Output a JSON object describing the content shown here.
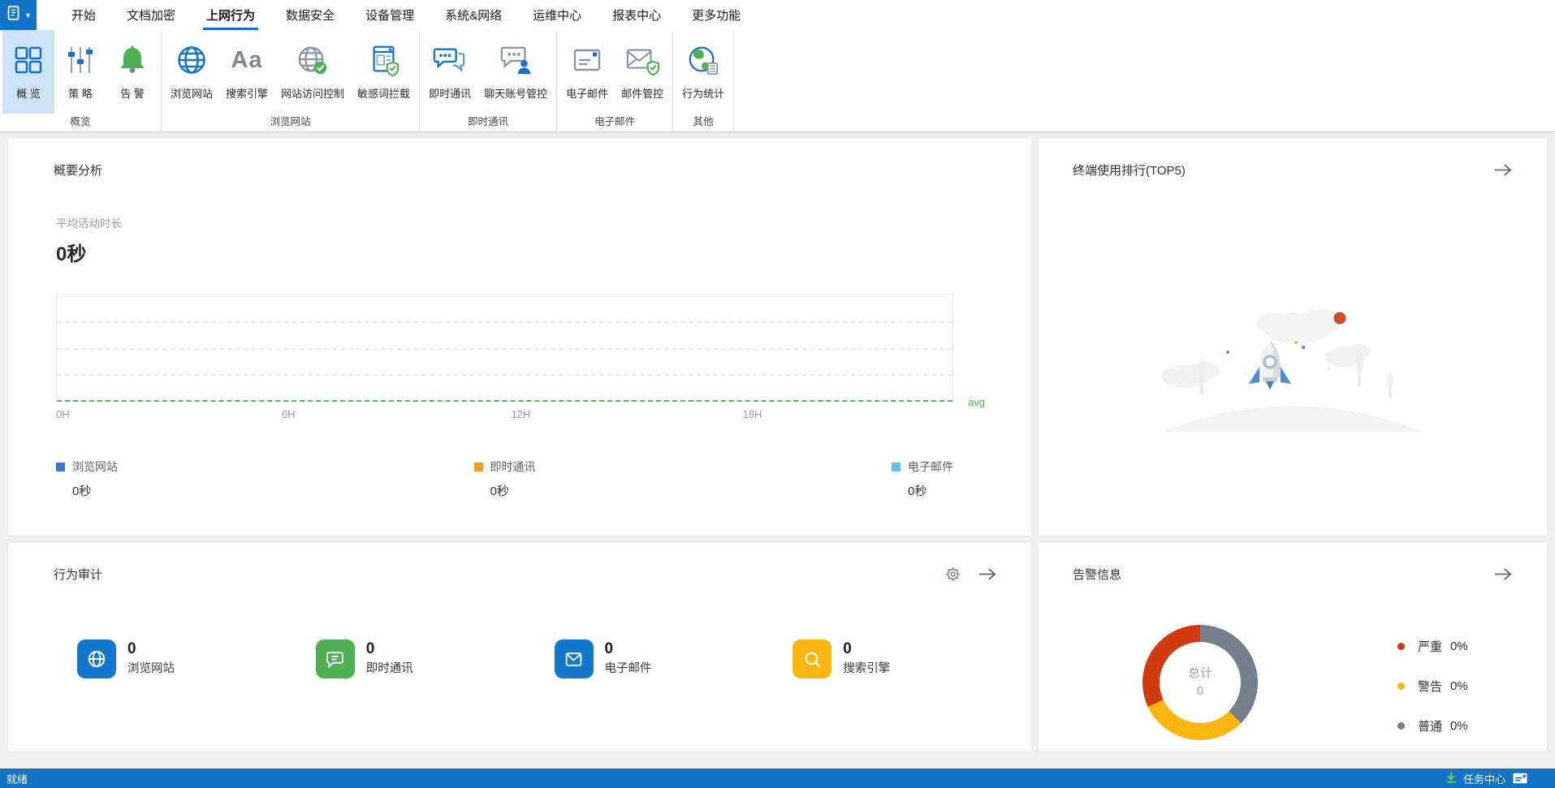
{
  "menubar": {
    "tabs": [
      "开始",
      "文档加密",
      "上网行为",
      "数据安全",
      "设备管理",
      "系统&网络",
      "运维中心",
      "报表中心",
      "更多功能"
    ],
    "active_tab": "上网行为"
  },
  "ribbon": {
    "groups": [
      {
        "label": "概览",
        "buttons": [
          {
            "label": "概 览",
            "selected": true
          },
          {
            "label": "策 略"
          },
          {
            "label": "告 警"
          }
        ]
      },
      {
        "label": "浏览网站",
        "buttons": [
          {
            "label": "浏览网站"
          },
          {
            "label": "搜索引擎",
            "glyph": "Aa"
          },
          {
            "label": "网站访问控制"
          },
          {
            "label": "敏感词拦截"
          }
        ]
      },
      {
        "label": "即时通讯",
        "buttons": [
          {
            "label": "即时通讯"
          },
          {
            "label": "聊天账号管控"
          }
        ]
      },
      {
        "label": "电子邮件",
        "buttons": [
          {
            "label": "电子邮件"
          },
          {
            "label": "邮件管控"
          }
        ]
      },
      {
        "label": "其他",
        "buttons": [
          {
            "label": "行为统计"
          }
        ]
      }
    ]
  },
  "summary": {
    "title": "概要分析",
    "metric_label": "平均活动时长",
    "metric_value": "0秒",
    "x_ticks": [
      "0H",
      "6H",
      "12H",
      "18H"
    ],
    "avg_label": "avg",
    "legend": [
      {
        "label": "浏览网站",
        "value": "0秒",
        "color": "#3a76d2"
      },
      {
        "label": "即时通讯",
        "value": "0秒",
        "color": "#f59b22"
      },
      {
        "label": "电子邮件",
        "value": "0秒",
        "color": "#66c2de"
      }
    ]
  },
  "ranking": {
    "title": "终端使用排行(TOP5)"
  },
  "audit": {
    "title": "行为审计",
    "stats": [
      {
        "label": "浏览网站",
        "value": "0",
        "color": "#1377cb"
      },
      {
        "label": "即时通讯",
        "value": "0",
        "color": "#4db052"
      },
      {
        "label": "电子邮件",
        "value": "0",
        "color": "#1377cb"
      },
      {
        "label": "搜索引擎",
        "value": "0",
        "color": "#fbb70f"
      }
    ]
  },
  "alerts": {
    "title": "告警信息",
    "center_label": "总计",
    "center_value": "0",
    "legend": [
      {
        "label": "严重",
        "value": "0%",
        "color": "#d23a10"
      },
      {
        "label": "警告",
        "value": "0%",
        "color": "#fbb612"
      },
      {
        "label": "普通",
        "value": "0%",
        "color": "#75808e"
      }
    ]
  },
  "statusbar": {
    "ready": "就绪",
    "task_center": "任务中心"
  },
  "colors": {
    "primary_blue": "#1273c6",
    "ribbon_selected_bg": "#cde3f6",
    "green": "#4db052",
    "avg_line_green": "#52b748",
    "page_background": "#edeff1"
  },
  "chart_data": [
    {
      "type": "line",
      "title": "概要分析 - 平均活动时长",
      "x_ticks": [
        "0H",
        "6H",
        "12H",
        "18H"
      ],
      "x_range_hours": [
        0,
        24
      ],
      "series": [
        {
          "name": "浏览网站",
          "color": "#3a76d2",
          "total": "0秒",
          "values": [
            0,
            0,
            0,
            0
          ]
        },
        {
          "name": "即时通讯",
          "color": "#f59b22",
          "total": "0秒",
          "values": [
            0,
            0,
            0,
            0
          ]
        },
        {
          "name": "电子邮件",
          "color": "#66c2de",
          "total": "0秒",
          "values": [
            0,
            0,
            0,
            0
          ]
        }
      ],
      "avg_line": {
        "label": "avg",
        "value": 0,
        "color": "#52b748",
        "style": "dashed"
      },
      "grid": {
        "horizontal_dashed_lines": 3
      },
      "legend_position": "bottom"
    },
    {
      "type": "donut",
      "title": "告警信息",
      "center_label": "总计",
      "center_value": 0,
      "segments": [
        {
          "label": "严重",
          "percent": "0%",
          "color": "#d23a10"
        },
        {
          "label": "警告",
          "percent": "0%",
          "color": "#fbb612"
        },
        {
          "label": "普通",
          "percent": "0%",
          "color": "#75808e"
        }
      ],
      "draw_segments": [
        {
          "color": "#75808e",
          "sweep_deg": 135
        },
        {
          "color": "#fbb612",
          "sweep_deg": 110
        },
        {
          "color": "#d23a10",
          "sweep_deg": 115
        }
      ],
      "legend_position": "right"
    }
  ]
}
